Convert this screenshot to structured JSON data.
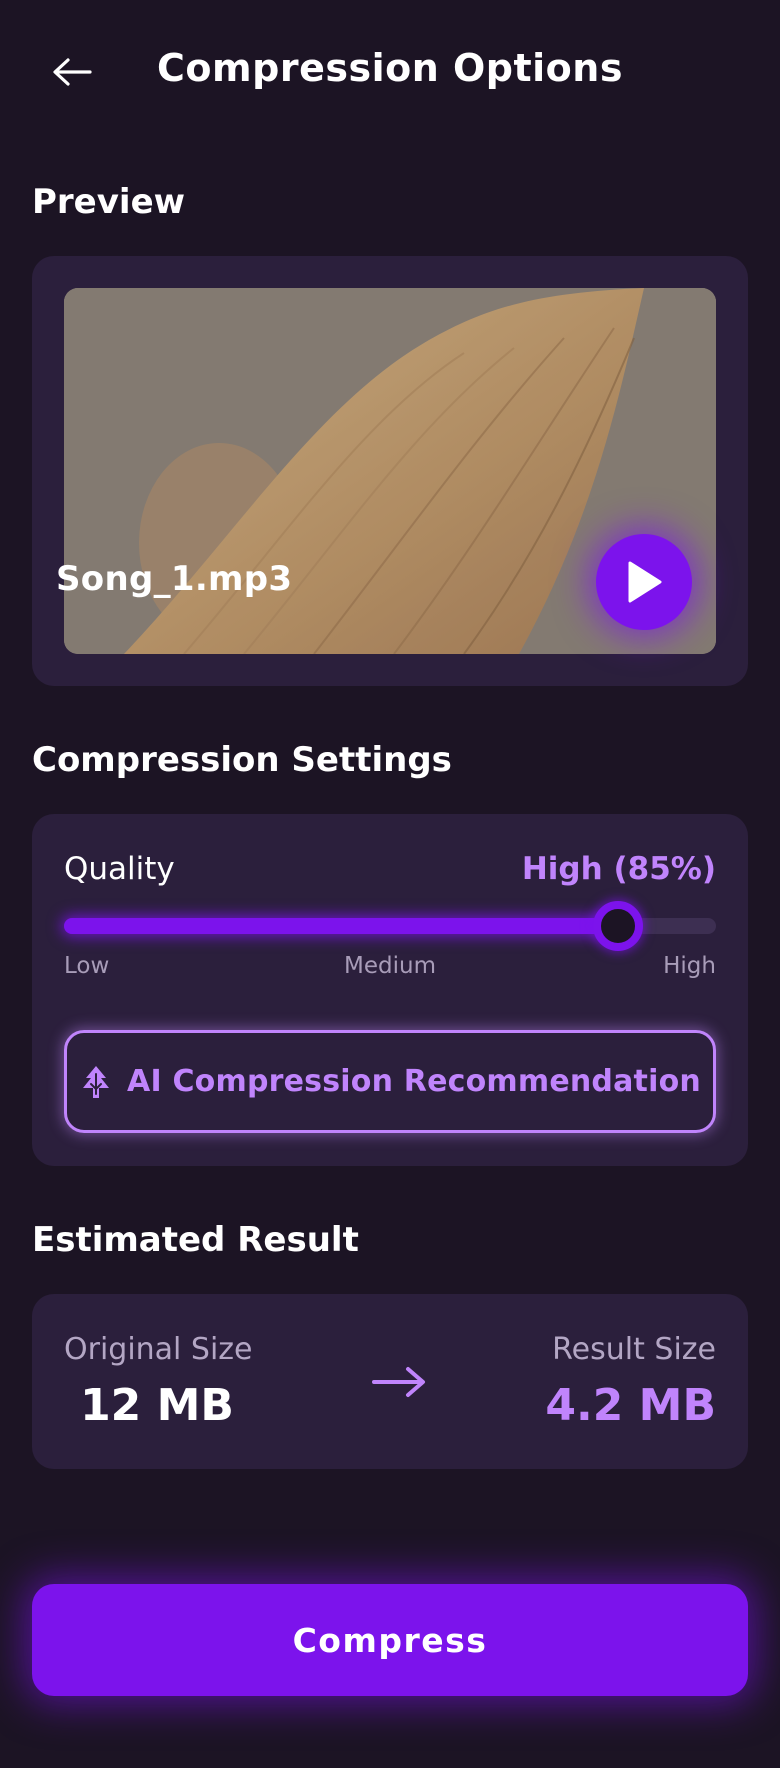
{
  "header": {
    "title": "Compression Options",
    "back_icon": "arrow-left-icon"
  },
  "preview": {
    "section_title": "Preview",
    "file_name": "Song_1.mp3",
    "play_icon": "play-icon"
  },
  "settings": {
    "section_title": "Compression Settings",
    "quality_label": "Quality",
    "quality_value_text": "High (85%)",
    "quality_level": 0.85,
    "tick_low": "Low",
    "tick_medium": "Medium",
    "tick_high": "High",
    "ai_button_label": "AI Compression Recommendation",
    "ai_icon": "sparkle-tree-icon"
  },
  "estimate": {
    "section_title": "Estimated Result",
    "original_label": "Original Size",
    "original_value": "12 MB",
    "result_label": "Result Size",
    "result_value": "4.2 MB",
    "arrow_icon": "arrow-right-icon"
  },
  "actions": {
    "compress_label": "Compress"
  },
  "colors": {
    "background": "#1c1424",
    "card": "#2b1f3c",
    "accent": "#7c13ec",
    "accent_light": "#c084fc"
  }
}
